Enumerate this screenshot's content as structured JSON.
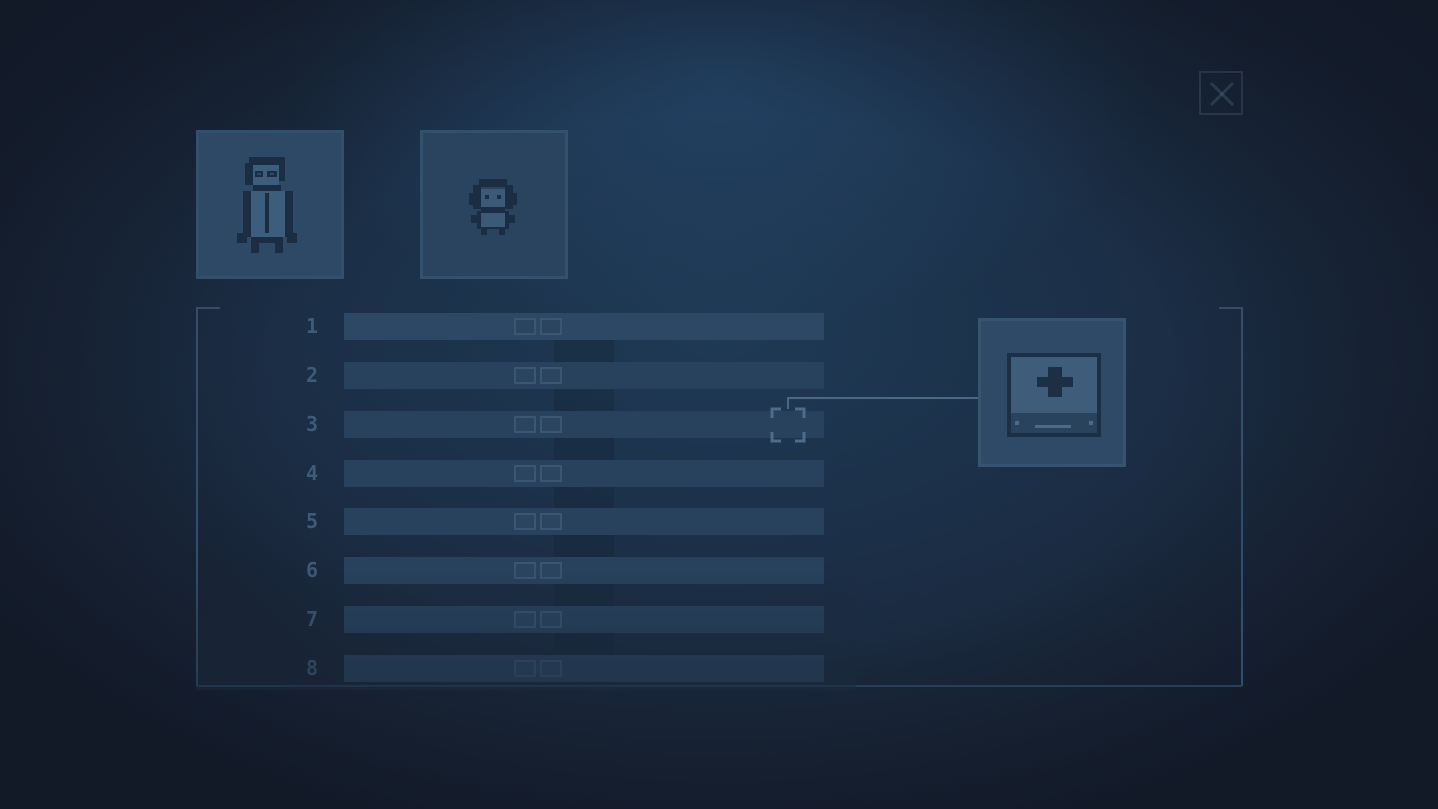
{
  "screen": "party-inventory",
  "close_button": {
    "icon": "close-icon"
  },
  "characters": [
    {
      "icon": "scientist-character-icon"
    },
    {
      "icon": "girl-character-icon"
    }
  ],
  "slots": [
    {
      "number": "1"
    },
    {
      "number": "2"
    },
    {
      "number": "3"
    },
    {
      "number": "4"
    },
    {
      "number": "5"
    },
    {
      "number": "6"
    },
    {
      "number": "7"
    },
    {
      "number": "8"
    }
  ],
  "selected_slot": "3",
  "selected_item": {
    "icon": "medkit-icon"
  },
  "colors": {
    "background": "#1b2d44",
    "panel": "#2e4a66",
    "row": "#28425d",
    "accent": "#3e5b78"
  }
}
